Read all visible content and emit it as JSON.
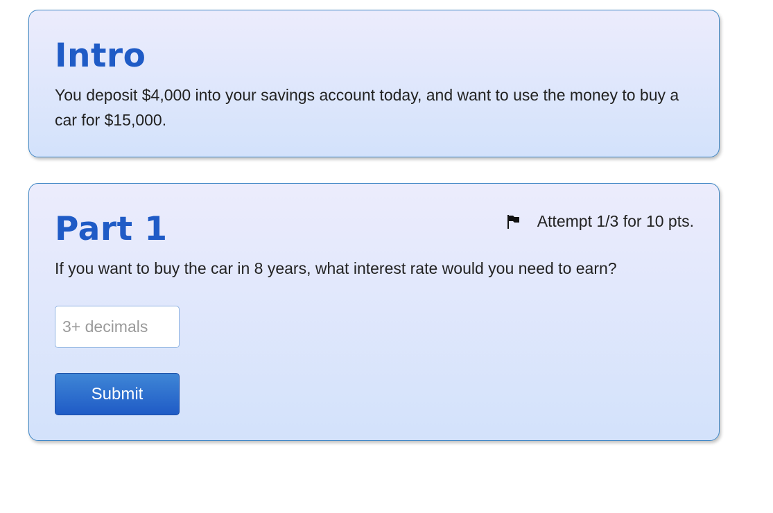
{
  "intro": {
    "title": "Intro",
    "text": "You deposit $4,000 into your savings account today, and want to use the money to buy a car for $15,000."
  },
  "part1": {
    "title": "Part 1",
    "attempt_text": "Attempt 1/3 for 10 pts.",
    "flag_icon": "flag-icon",
    "question": "If you want to buy the car in 8 years, what interest rate would you need to earn?",
    "answer_placeholder": "3+ decimals",
    "answer_value": "",
    "submit_label": "Submit"
  },
  "colors": {
    "heading": "#1f5bc6",
    "card_border": "#3f86c4",
    "button": "#1f5bc6"
  }
}
